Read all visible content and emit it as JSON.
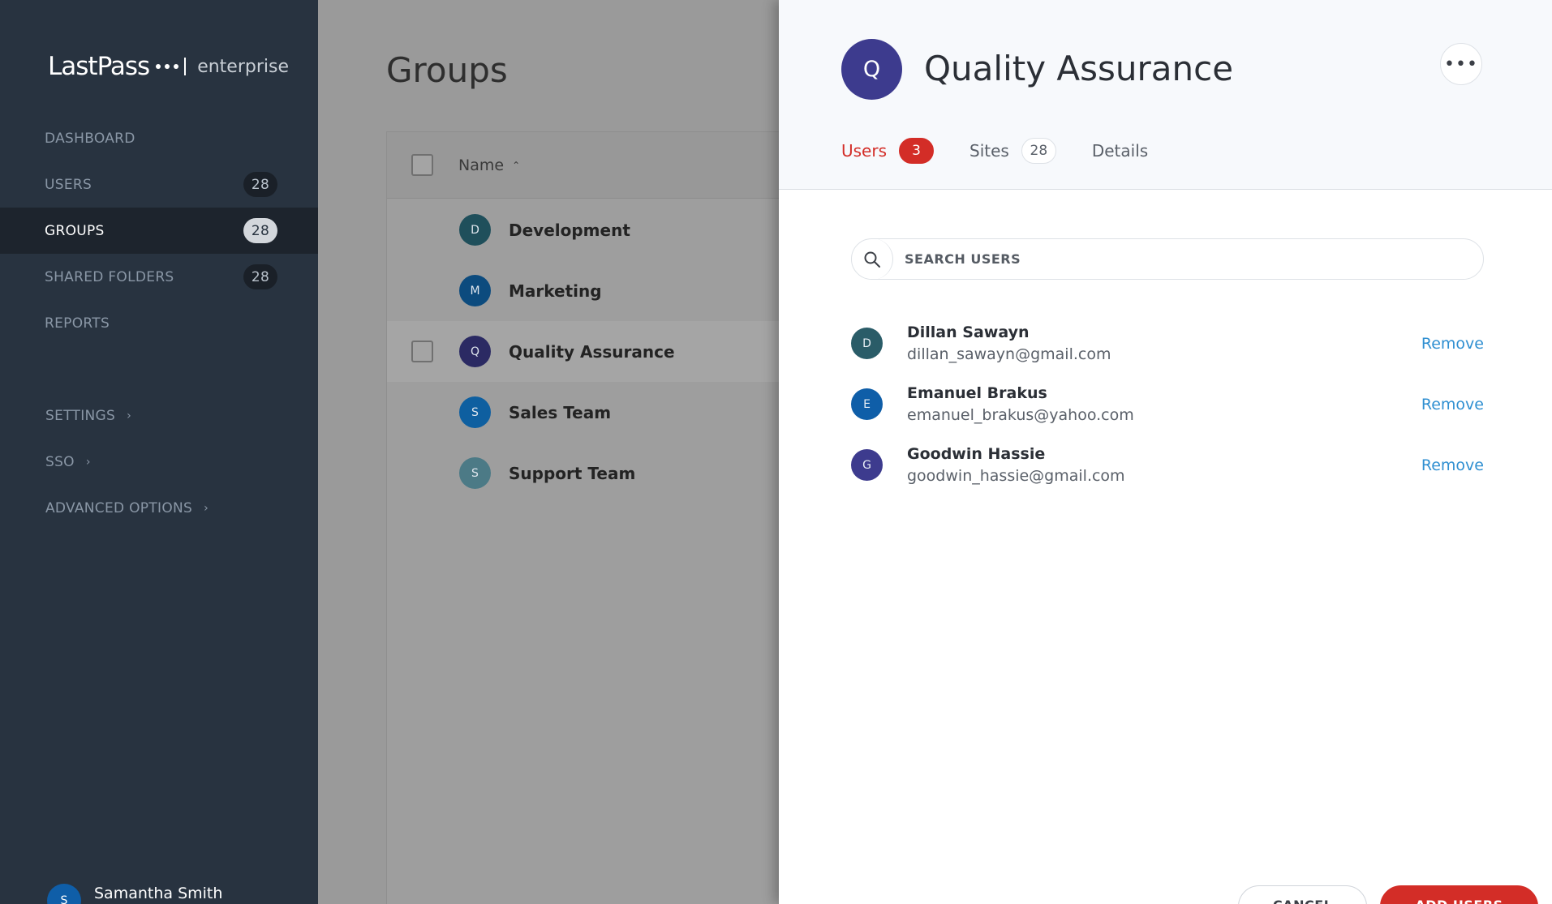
{
  "logo": {
    "main": "LastPass",
    "sub": "enterprise"
  },
  "sidebar": {
    "items": [
      {
        "label": "DASHBOARD",
        "badge": ""
      },
      {
        "label": "USERS",
        "badge": "28"
      },
      {
        "label": "GROUPS",
        "badge": "28",
        "active": true
      },
      {
        "label": "SHARED FOLDERS",
        "badge": "28"
      },
      {
        "label": "REPORTS",
        "badge": ""
      }
    ],
    "sub_items": [
      {
        "label": "SETTINGS"
      },
      {
        "label": "SSO"
      },
      {
        "label": "ADVANCED OPTIONS"
      }
    ],
    "user": {
      "initial": "S",
      "name": "Samantha Smith"
    }
  },
  "main": {
    "title": "Groups",
    "table": {
      "header_name": "Name",
      "rows": [
        {
          "initial": "D",
          "name": "Development",
          "color": "#1f4f5b"
        },
        {
          "initial": "M",
          "name": "Marketing",
          "color": "#0c4b7e"
        },
        {
          "initial": "Q",
          "name": "Quality Assurance",
          "color": "#2b2a63"
        },
        {
          "initial": "S",
          "name": "Sales Team",
          "color": "#0e5fa0"
        },
        {
          "initial": "S",
          "name": "Support Team",
          "color": "#4c7a86"
        }
      ]
    }
  },
  "panel": {
    "initial": "Q",
    "title": "Quality Assurance",
    "tabs": [
      {
        "label": "Users",
        "badge": "3"
      },
      {
        "label": "Sites",
        "badge": "28"
      },
      {
        "label": "Details",
        "badge": ""
      }
    ],
    "search": {
      "placeholder": "SEARCH USERS"
    },
    "users": [
      {
        "initial": "D",
        "name": "Dillan Sawayn",
        "email": "dillan_sawayn@gmail.com",
        "color": "#2a5c68",
        "action": "Remove"
      },
      {
        "initial": "E",
        "name": "Emanuel Brakus",
        "email": "emanuel_brakus@yahoo.com",
        "color": "#0f5ea8",
        "action": "Remove"
      },
      {
        "initial": "G",
        "name": "Goodwin Hassie",
        "email": "goodwin_hassie@gmail.com",
        "color": "#3d3b8e",
        "action": "Remove"
      }
    ],
    "buttons": {
      "cancel": "CANCEL",
      "add": "ADD USERS"
    }
  },
  "colors": {
    "accent": "#d32d27",
    "link": "#2f8fd1",
    "sidebar": "#283340"
  }
}
